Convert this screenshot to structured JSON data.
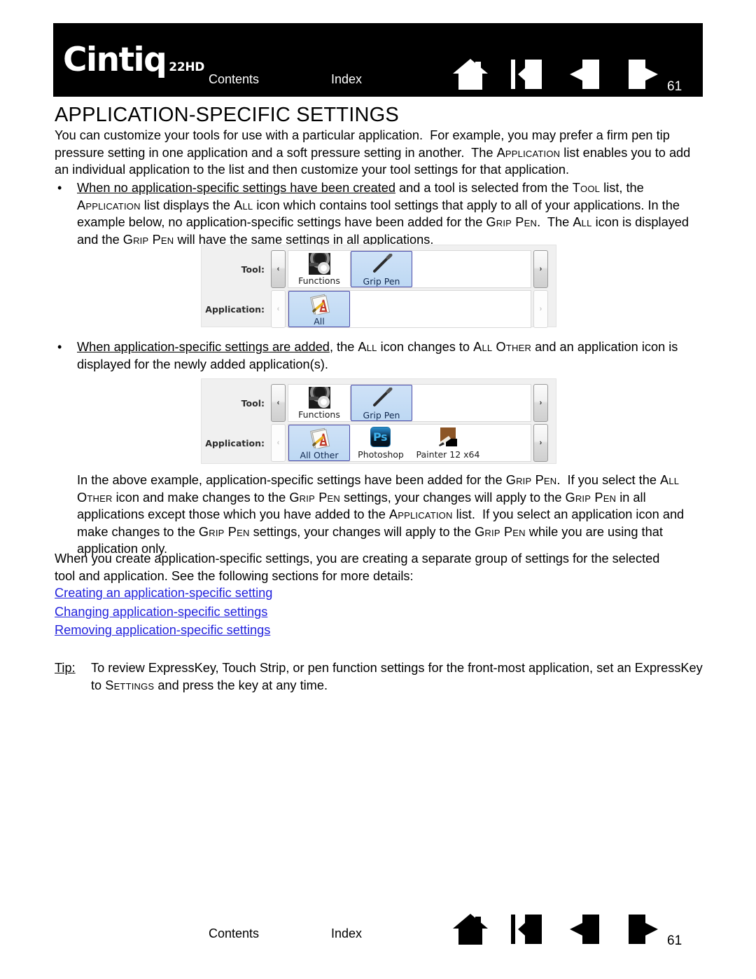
{
  "header": {
    "logo_text": "Cintiq",
    "logo_sub": "22HD",
    "contents_label": "Contents",
    "index_label": "Index",
    "page_number": "61",
    "icons": [
      "home-icon",
      "back-to-start-icon",
      "previous-page-icon",
      "next-page-icon"
    ]
  },
  "page": {
    "title": "APPLICATION-SPECIFIC SETTINGS",
    "intro": "You can customize your tools for use with a particular application.  For example, you may prefer a firm pen tip pressure setting in one application and a soft pressure setting in another.  The APPLICATION list enables you to add an individual application to the list and then customize your tool settings for that application.",
    "bullet_dot": "•",
    "bullet1_lead": "When no application-specific settings have been created",
    "bullet1_rest": " and a tool is selected from the TOOL list, the APPLICATION list displays the ALL icon which contains tool settings that apply to all of your applications.  In the example below, no application-specific settings have been added for the GRIP PEN.  The ALL icon is displayed and the GRIP PEN will have the same settings in all applications.",
    "bullet2_lead": "When application-specific settings are added",
    "bullet2_rest": ", the ALL icon changes to ALL OTHER and an application icon is displayed for the newly added application(s).",
    "para_after_widget2": "In the above example, application-specific settings have been added for the GRIP PEN.  If you select the ALL OTHER icon and make changes to the GRIP PEN settings, your changes will apply to the GRIP PEN in all applications except those which you have added to the APPLICATION list.  If you select an application icon and make changes to the GRIP PEN settings, your changes will apply to the GRIP PEN while you are using that application only.",
    "para_group": "When you create application-specific settings, you are creating a separate group of settings for the selected tool and application.  See the following sections for more details:",
    "links": [
      "Creating an application-specific setting",
      "Changing application-specific settings",
      "Removing application-specific settings"
    ],
    "link_color": "#2222dd",
    "tip_label": "Tip:",
    "tip_text": "To review ExpressKey, Touch Strip, or pen function settings for the front-most application, set an ExpressKey to SETTINGS and press the key at any time."
  },
  "widget1": {
    "tool_label": "Tool:",
    "application_label": "Application:",
    "prev_arrow": "‹",
    "next_arrow": "›",
    "tool_items": [
      {
        "label": "Functions",
        "icon": "functions-icon",
        "selected": false
      },
      {
        "label": "Grip Pen",
        "icon": "grip-pen-icon",
        "selected": true
      }
    ],
    "application_items": [
      {
        "label": "All",
        "icon": "all-applications-icon",
        "selected": true
      }
    ],
    "tool_prev_enabled": true,
    "tool_next_enabled": true,
    "app_prev_enabled": false,
    "app_next_enabled": false
  },
  "widget2": {
    "tool_label": "Tool:",
    "application_label": "Application:",
    "prev_arrow": "‹",
    "next_arrow": "›",
    "tool_items": [
      {
        "label": "Functions",
        "icon": "functions-icon",
        "selected": false
      },
      {
        "label": "Grip Pen",
        "icon": "grip-pen-icon",
        "selected": true
      }
    ],
    "application_items": [
      {
        "label": "All Other",
        "icon": "all-other-applications-icon",
        "selected": true
      },
      {
        "label": "Photoshop",
        "icon": "photoshop-icon",
        "selected": false
      },
      {
        "label": "Painter 12 x64",
        "icon": "painter-icon",
        "selected": false
      }
    ],
    "tool_prev_enabled": true,
    "tool_next_enabled": true,
    "app_prev_enabled": false,
    "app_next_enabled": true
  },
  "footer": {
    "contents_label": "Contents",
    "index_label": "Index",
    "page_number": "61",
    "icons": [
      "home-icon",
      "back-to-start-icon",
      "previous-page-icon",
      "next-page-icon"
    ]
  }
}
